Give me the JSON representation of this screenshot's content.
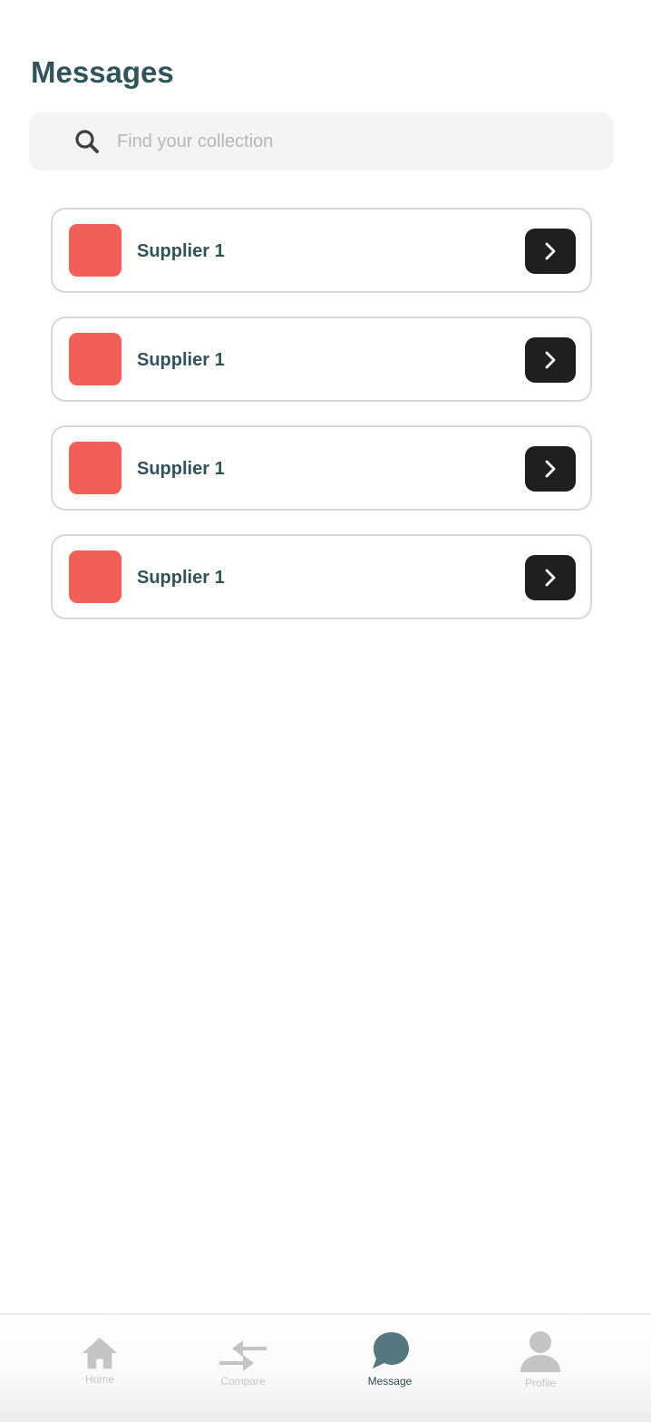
{
  "header": {
    "title": "Messages"
  },
  "search": {
    "placeholder": "Find your collection",
    "value": "",
    "icon": "search-icon"
  },
  "conversations": [
    {
      "name": "Supplier 1",
      "thumb_color": "#f05f5a",
      "action_icon": "chevron-right-icon"
    },
    {
      "name": "Supplier 1",
      "thumb_color": "#f05f5a",
      "action_icon": "chevron-right-icon"
    },
    {
      "name": "Supplier 1",
      "thumb_color": "#f05f5a",
      "action_icon": "chevron-right-icon"
    },
    {
      "name": "Supplier 1",
      "thumb_color": "#f05f5a",
      "action_icon": "chevron-right-icon"
    }
  ],
  "bottom_nav": {
    "items": [
      {
        "label": "Home",
        "icon": "home-icon",
        "active": false
      },
      {
        "label": "Compare",
        "icon": "compare-arrows-icon",
        "active": false
      },
      {
        "label": "Message",
        "icon": "chat-bubble-icon",
        "active": true
      },
      {
        "label": "Profile",
        "icon": "user-icon",
        "active": false
      }
    ]
  },
  "colors": {
    "title": "#2f5459",
    "accent_active": "#557880",
    "inactive": "#c4c4c4",
    "thumb": "#f05f5a",
    "chevron_button": "#1f1f1f",
    "search_bg": "#f4f4f4"
  }
}
